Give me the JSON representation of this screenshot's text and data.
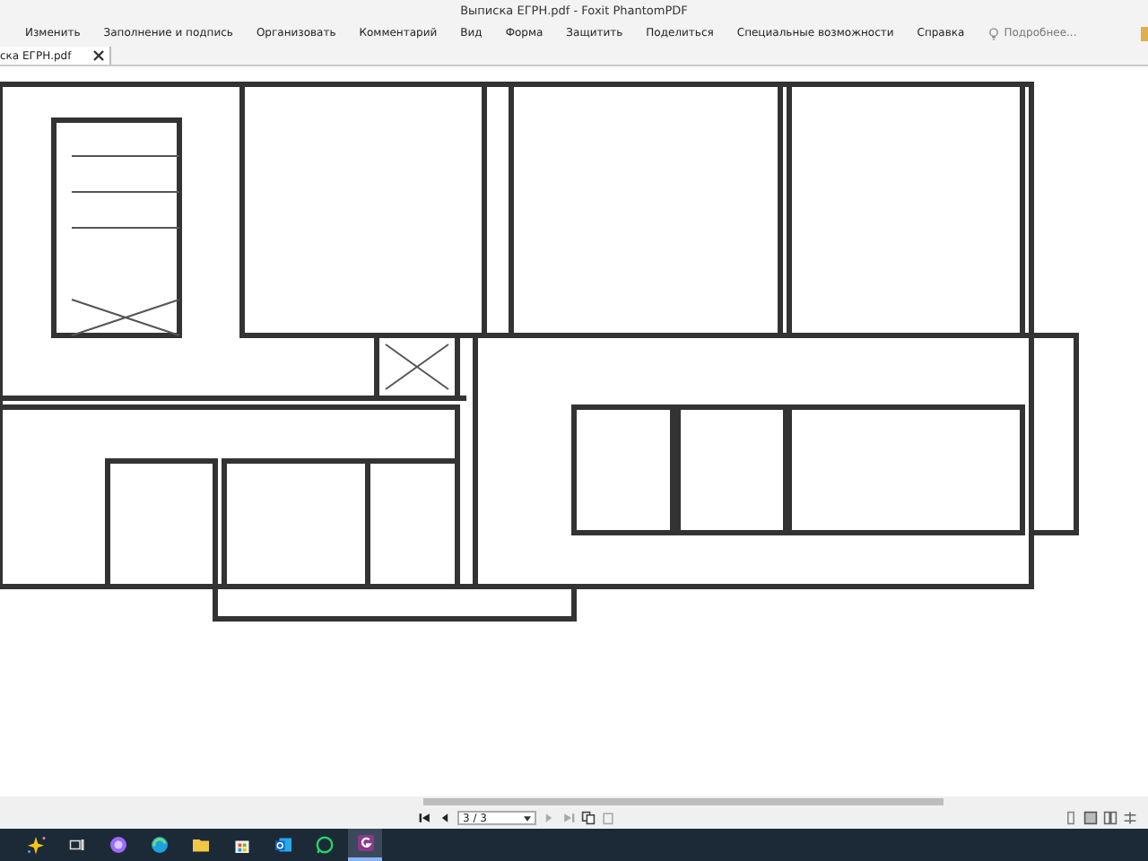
{
  "window": {
    "title": "Выписка ЕГРН.pdf - Foxit PhantomPDF"
  },
  "menu": [
    {
      "label": "Изменить"
    },
    {
      "label": "Заполнение и подпись"
    },
    {
      "label": "Организовать"
    },
    {
      "label": "Комментарий"
    },
    {
      "label": "Вид"
    },
    {
      "label": "Форма"
    },
    {
      "label": "Защитить"
    },
    {
      "label": "Поделиться"
    },
    {
      "label": "Специальные возможности"
    },
    {
      "label": "Справка"
    }
  ],
  "tell_me": {
    "placeholder": "Подробнее..."
  },
  "tabs": [
    {
      "label": "ска ЕГРН.pdf",
      "selected": true
    }
  ],
  "navigation": {
    "page": "3 / 3"
  },
  "taskbar": [
    {
      "kind": "sparkle",
      "selected": false
    },
    {
      "kind": "taskview",
      "selected": false
    },
    {
      "kind": "circle",
      "selected": false
    },
    {
      "kind": "browser",
      "selected": false
    },
    {
      "kind": "folder",
      "selected": false
    },
    {
      "kind": "store",
      "selected": false
    },
    {
      "kind": "mail",
      "selected": false
    },
    {
      "kind": "chat",
      "selected": false
    },
    {
      "kind": "pdf",
      "selected": true
    }
  ]
}
